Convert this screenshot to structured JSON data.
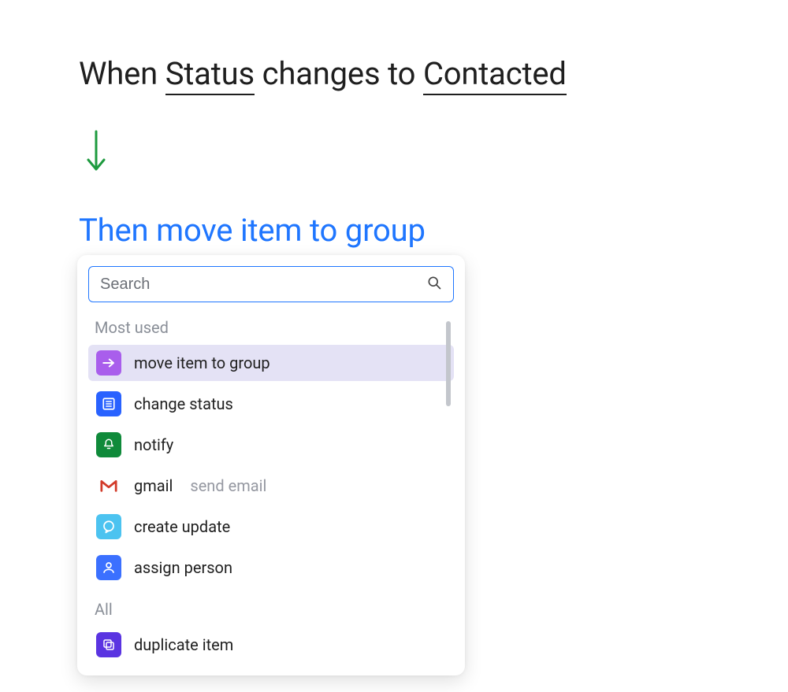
{
  "trigger": {
    "prefix": "When ",
    "column": "Status",
    "mid": " changes to ",
    "value": "Contacted"
  },
  "action": {
    "prefix": "Then ",
    "selected": "move item to group"
  },
  "dropdown": {
    "search_placeholder": "Search",
    "sections": {
      "most_used_label": "Most used",
      "all_label": "All"
    },
    "most_used": [
      {
        "label": "move item to group",
        "icon": "arrow-right-icon",
        "color": "purple",
        "selected": true
      },
      {
        "label": "change status",
        "icon": "list-box-icon",
        "color": "blue",
        "selected": false
      },
      {
        "label": "notify",
        "icon": "bell-icon",
        "color": "green",
        "selected": false
      },
      {
        "label": "gmail",
        "sublabel": "send email",
        "icon": "gmail-icon",
        "color": "gmail",
        "selected": false
      },
      {
        "label": "create update",
        "icon": "speech-bubble-icon",
        "color": "sky",
        "selected": false
      },
      {
        "label": "assign person",
        "icon": "person-icon",
        "color": "royal",
        "selected": false
      }
    ],
    "all": [
      {
        "label": "duplicate item",
        "icon": "duplicate-icon",
        "color": "violet",
        "selected": false
      }
    ]
  }
}
